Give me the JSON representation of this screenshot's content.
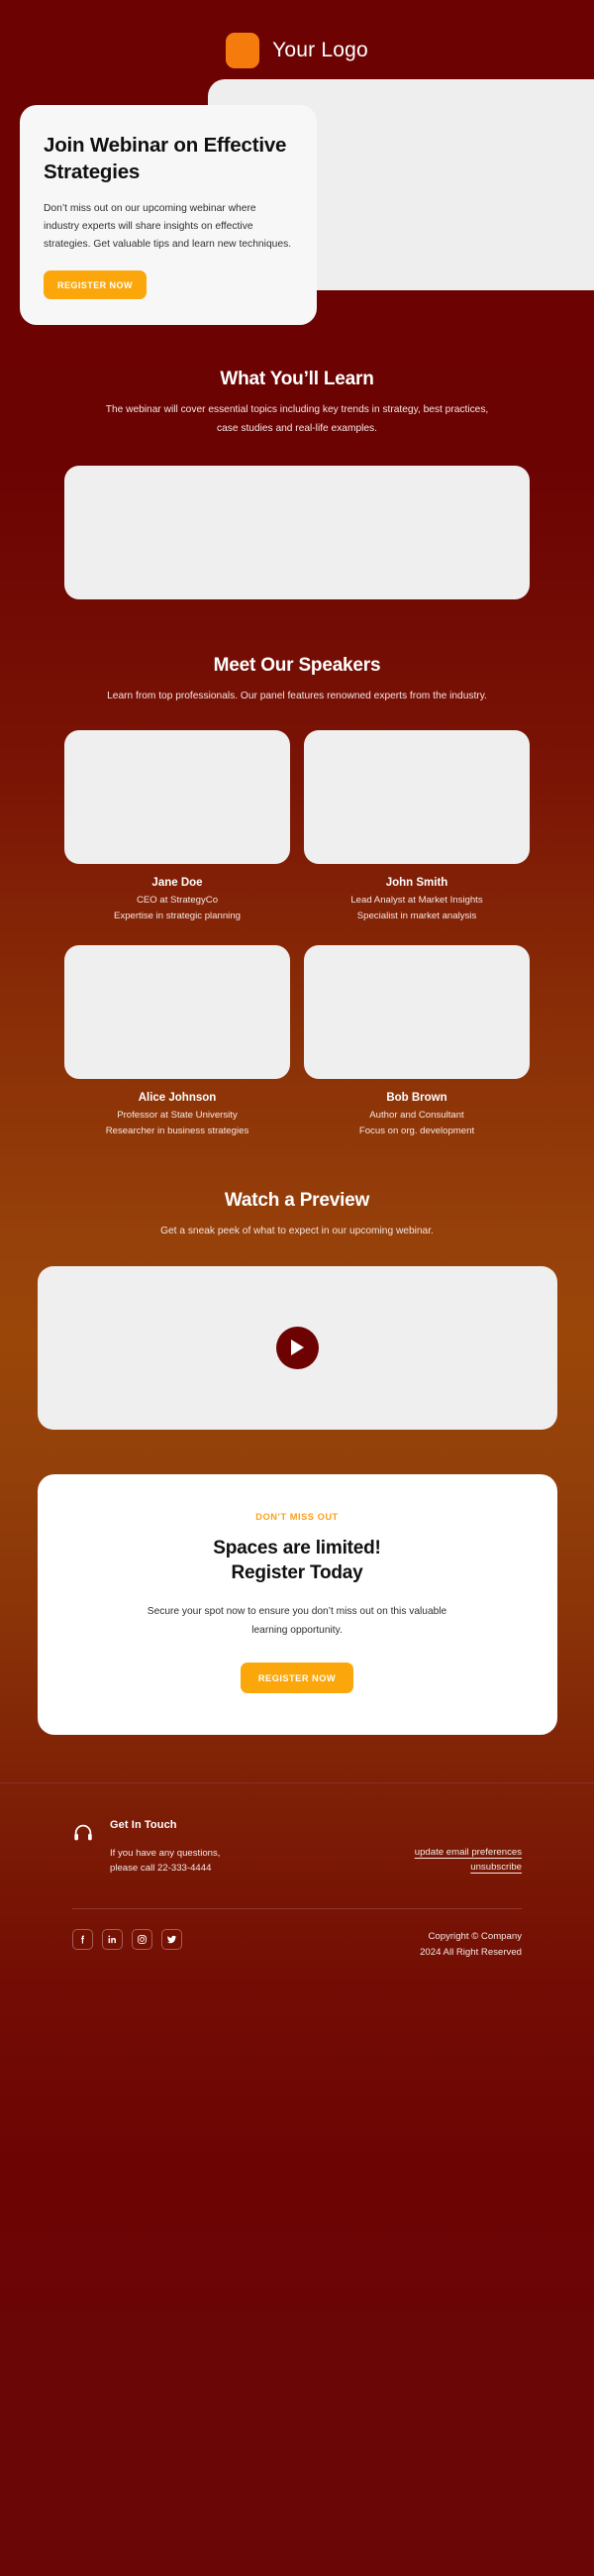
{
  "brand": {
    "logo_text": "Your Logo",
    "logo_icon": "rounded-square-logo",
    "accent_orange": "#f57c0c",
    "button_orange": "#fba70c",
    "background_dark_red": "#6d0202",
    "background_mid_orange": "#9a4609",
    "footer_background": "#6b0606"
  },
  "hero": {
    "title": "Join Webinar on Effective Strategies",
    "body": "Don’t miss out on our upcoming webinar where industry experts will share insights on effective strategies. Get valuable tips and learn new techniques.",
    "cta_label": "REGISTER NOW",
    "image_alt": "hero-placeholder-image"
  },
  "learn": {
    "title": "What You’ll Learn",
    "subtitle": "The webinar will cover essential topics including key trends in strategy, best practices, case studies and real-life examples.",
    "image_alt": "learn-placeholder-image"
  },
  "speakers": {
    "title": "Meet Our Speakers",
    "subtitle": "Learn from top professionals. Our panel features renowned experts from the industry.",
    "items": [
      {
        "name": "Jane Doe",
        "role": "CEO at StrategyCo",
        "note": "Expertise in strategic planning",
        "photo_alt": "speaker-photo-placeholder"
      },
      {
        "name": "John Smith",
        "role": "Lead Analyst at Market Insights",
        "note": "Specialist in market analysis",
        "photo_alt": "speaker-photo-placeholder"
      },
      {
        "name": "Alice Johnson",
        "role": "Professor at State University",
        "note": "Researcher in business strategies",
        "photo_alt": "speaker-photo-placeholder"
      },
      {
        "name": "Bob Brown",
        "role": "Author and Consultant",
        "note": "Focus on org. development",
        "photo_alt": "speaker-photo-placeholder"
      }
    ]
  },
  "preview": {
    "title": "Watch a Preview",
    "subtitle": "Get a sneak peek of what to expect in our upcoming webinar.",
    "play_icon": "play-icon"
  },
  "cta": {
    "eyebrow": "DON’T MISS OUT",
    "title_line1": "Spaces are limited!",
    "title_line2": "Register Today",
    "body": "Secure your spot now to ensure you don’t miss out on this valuable learning opportunity.",
    "button_label": "REGISTER NOW"
  },
  "footer": {
    "contact_icon": "headphones-icon",
    "contact_title": "Get In Touch",
    "contact_line1": "If you have any questions,",
    "contact_line2": "please call 22-333-4444",
    "links": [
      {
        "label": "update email preferences"
      },
      {
        "label": "unsubscribe"
      }
    ],
    "socials": [
      {
        "name": "facebook-icon"
      },
      {
        "name": "linkedin-icon"
      },
      {
        "name": "instagram-icon"
      },
      {
        "name": "twitter-icon"
      }
    ],
    "copyright_line1": "Copyright © Company",
    "copyright_line2": "2024 All Right Reserved"
  }
}
